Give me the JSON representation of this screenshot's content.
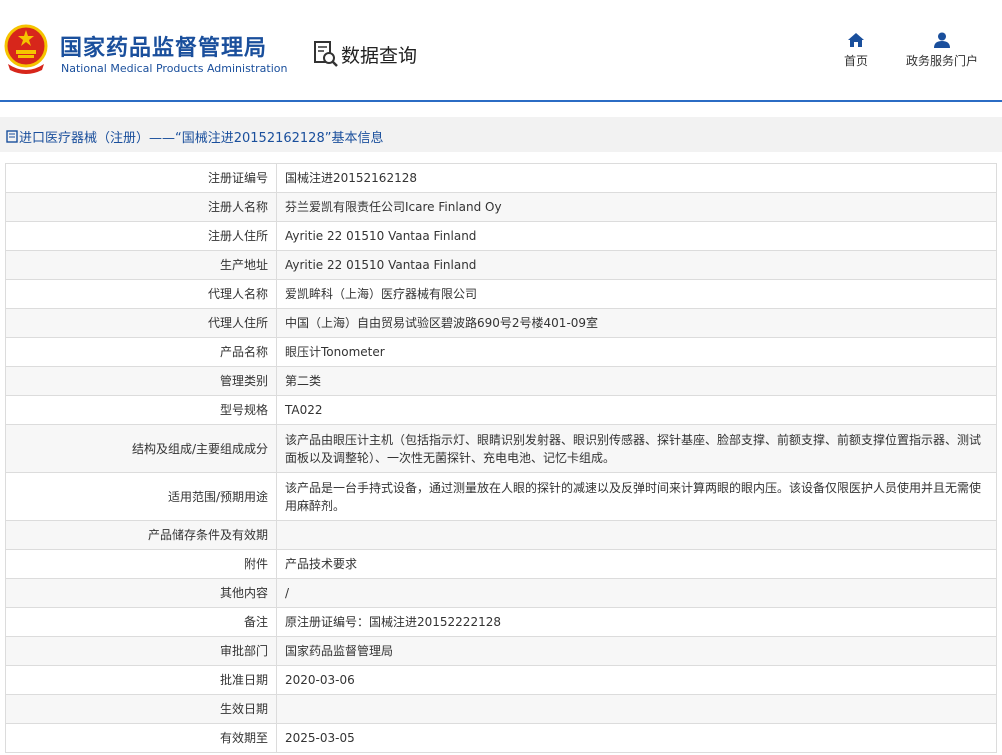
{
  "header": {
    "logo_cn": "国家药品监督管理局",
    "logo_en": "National Medical Products Administration",
    "query_label": "数据查询",
    "nav_home": "首页",
    "nav_portal": "政务服务门户"
  },
  "breadcrumb": {
    "text": "进口医疗器械（注册）——“国械注进20152162128”基本信息"
  },
  "colors": {
    "brand": "#1a4f9c",
    "accent_line": "#2b6cc4",
    "emblem_red": "#d7261b",
    "emblem_gold": "#f5c400"
  },
  "rows": [
    {
      "label": "注册证编号",
      "value": "国械注进20152162128"
    },
    {
      "label": "注册人名称",
      "value": "芬兰爱凯有限责任公司Icare Finland Oy"
    },
    {
      "label": "注册人住所",
      "value": "Ayritie 22 01510 Vantaa Finland"
    },
    {
      "label": "生产地址",
      "value": "Ayritie 22 01510 Vantaa Finland"
    },
    {
      "label": "代理人名称",
      "value": "爱凯眸科（上海）医疗器械有限公司"
    },
    {
      "label": "代理人住所",
      "value": "中国（上海）自由贸易试验区碧波路690号2号楼401-09室"
    },
    {
      "label": "产品名称",
      "value": "眼压计Tonometer"
    },
    {
      "label": "管理类别",
      "value": "第二类"
    },
    {
      "label": "型号规格",
      "value": "TA022"
    },
    {
      "label": "结构及组成/主要组成成分",
      "value": "该产品由眼压计主机（包括指示灯、眼睛识别发射器、眼识别传感器、探针基座、脸部支撑、前额支撑、前额支撑位置指示器、测试面板以及调整轮）、一次性无菌探针、充电电池、记忆卡组成。"
    },
    {
      "label": "适用范围/预期用途",
      "value": "该产品是一台手持式设备，通过测量放在人眼的探针的减速以及反弹时间来计算两眼的眼内压。该设备仅限医护人员使用并且无需使用麻醉剂。"
    },
    {
      "label": "产品储存条件及有效期",
      "value": ""
    },
    {
      "label": "附件",
      "value": "产品技术要求"
    },
    {
      "label": "其他内容",
      "value": "/"
    },
    {
      "label": "备注",
      "value": "原注册证编号：国械注进20152222128"
    },
    {
      "label": "审批部门",
      "value": "国家药品监督管理局"
    },
    {
      "label": "批准日期",
      "value": "2020-03-06"
    },
    {
      "label": "生效日期",
      "value": ""
    },
    {
      "label": "有效期至",
      "value": "2025-03-05"
    }
  ]
}
